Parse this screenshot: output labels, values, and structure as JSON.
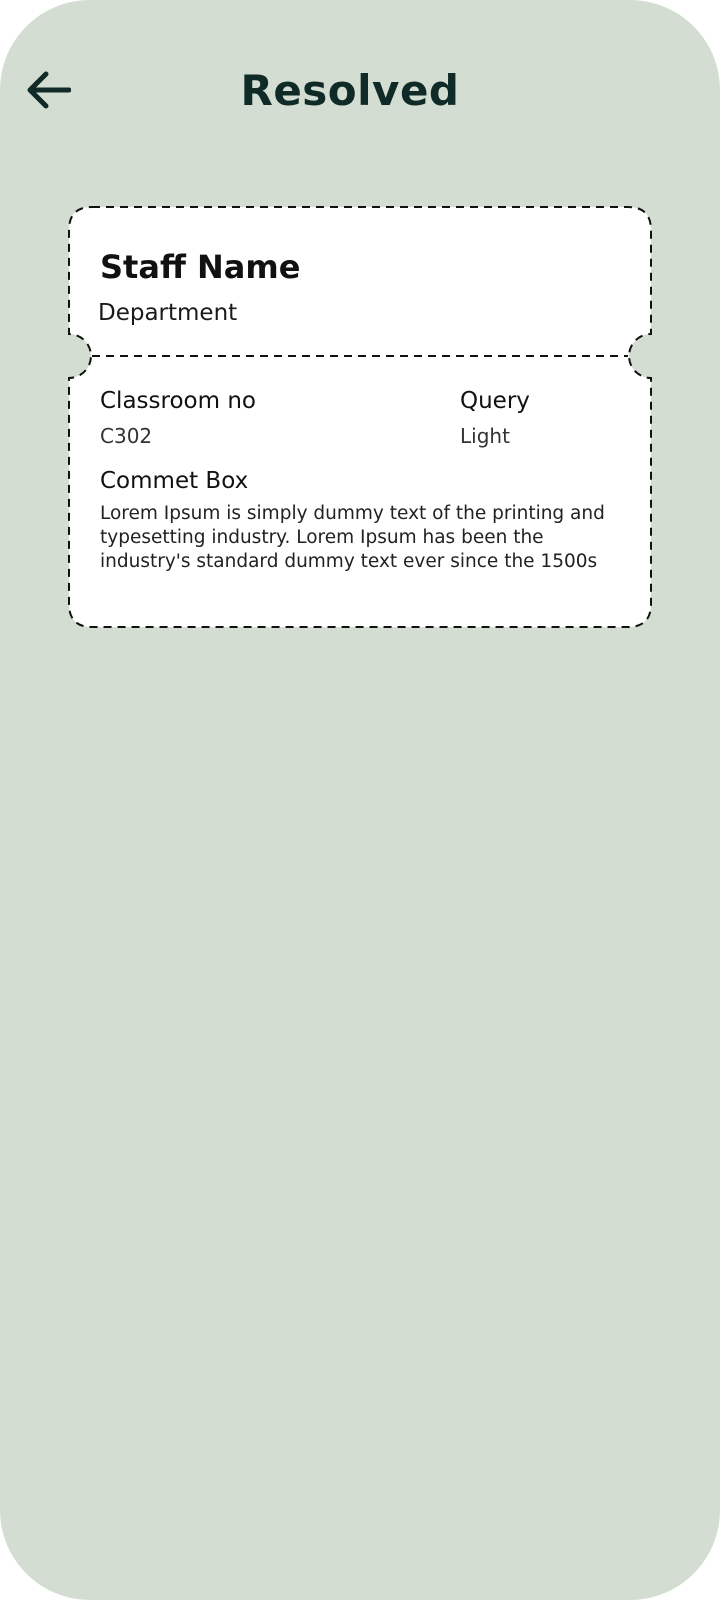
{
  "header": {
    "title": "Resolved",
    "back_icon": "arrow-left-icon"
  },
  "card": {
    "staff_name": "Staff Name",
    "department": "Department",
    "classroom_label": "Classroom no",
    "classroom_value": "C302",
    "query_label": "Query",
    "query_value": "Light",
    "comment_label": "Commet Box",
    "comment_text": "Lorem Ipsum is simply dummy text of the printing and typesetting industry. Lorem Ipsum has been the industry's standard dummy text ever since the 1500s"
  },
  "colors": {
    "background": "#d3ddd1",
    "title": "#0f2a27",
    "card": "#ffffff"
  }
}
